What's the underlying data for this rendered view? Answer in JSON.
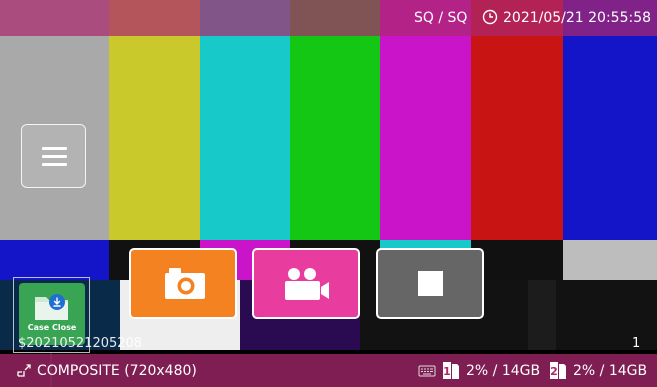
{
  "header": {
    "mode": "SQ / SQ",
    "datetime": "2021/05/21 20:55:58",
    "icon": "clock-icon"
  },
  "colors": {
    "overlay": "#aa286e",
    "photo_button": "#f58220",
    "record_button": "#e83c9f",
    "stop_button": "#666666",
    "case_tile": "#3aa455"
  },
  "menu": {
    "icon": "hamburger-icon"
  },
  "actions": {
    "photo_icon": "camera-icon",
    "record_icon": "video-camera-icon",
    "stop_icon": "stop-icon"
  },
  "case": {
    "label": "Case Close",
    "id": "$20210521205208",
    "counter": "1",
    "icon": "folder-download-icon"
  },
  "footer": {
    "input_icon": "input-source-icon",
    "input": "COMPOSITE (720x480)",
    "keyboard_icon": "keyboard-icon",
    "media": [
      {
        "badge": "1",
        "usage": "2% / 14GB",
        "icon": "sd-card-icon"
      },
      {
        "badge": "2",
        "usage": "2% / 14GB",
        "icon": "sd-card-icon"
      }
    ]
  }
}
